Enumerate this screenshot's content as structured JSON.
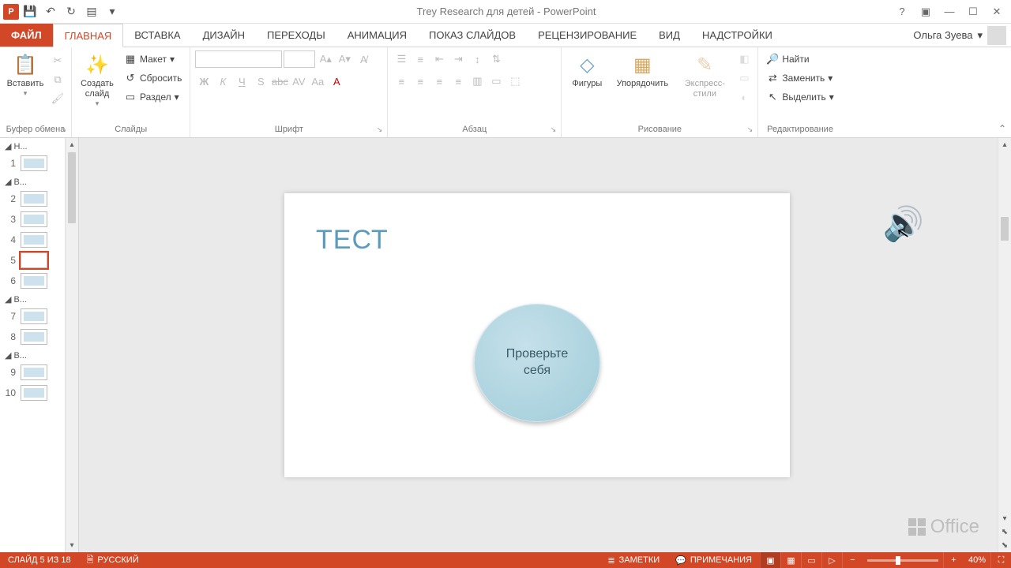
{
  "app": {
    "title": "Trey Research для детей - PowerPoint"
  },
  "qat": {
    "save": "💾",
    "undo": "↶",
    "redo": "↻",
    "start": "▤"
  },
  "user": {
    "name": "Ольга Зуева"
  },
  "tabs": {
    "file": "ФАЙЛ",
    "home": "ГЛАВНАЯ",
    "insert": "ВСТАВКА",
    "design": "ДИЗАЙН",
    "transitions": "ПЕРЕХОДЫ",
    "animations": "АНИМАЦИЯ",
    "slideshow": "ПОКАЗ СЛАЙДОВ",
    "review": "РЕЦЕНЗИРОВАНИЕ",
    "view": "ВИД",
    "addins": "НАДСТРОЙКИ"
  },
  "ribbon": {
    "clipboard": {
      "label": "Буфер обмена",
      "paste": "Вставить"
    },
    "slides": {
      "label": "Слайды",
      "new": "Создать слайд",
      "layout": "Макет",
      "reset": "Сбросить",
      "section": "Раздел"
    },
    "font": {
      "label": "Шрифт"
    },
    "paragraph": {
      "label": "Абзац"
    },
    "drawing": {
      "label": "Рисование",
      "shapes": "Фигуры",
      "arrange": "Упорядочить",
      "styles": "Экспресс-стили"
    },
    "editing": {
      "label": "Редактирование",
      "find": "Найти",
      "replace": "Заменить",
      "select": "Выделить"
    }
  },
  "panel": {
    "sections": [
      "Н...",
      "В...",
      "В...",
      "В..."
    ],
    "slides": [
      "1",
      "2",
      "3",
      "4",
      "5",
      "6",
      "7",
      "8",
      "9",
      "10"
    ],
    "active": "5"
  },
  "slide": {
    "title": "ТЕСТ",
    "circle_l1": "Проверьте",
    "circle_l2": "себя"
  },
  "status": {
    "slide": "СЛАЙД 5 ИЗ 18",
    "lang": "РУССКИЙ",
    "notes": "ЗАМЕТКИ",
    "comments": "ПРИМЕЧАНИЯ",
    "zoom": "40%"
  },
  "office": "Office"
}
